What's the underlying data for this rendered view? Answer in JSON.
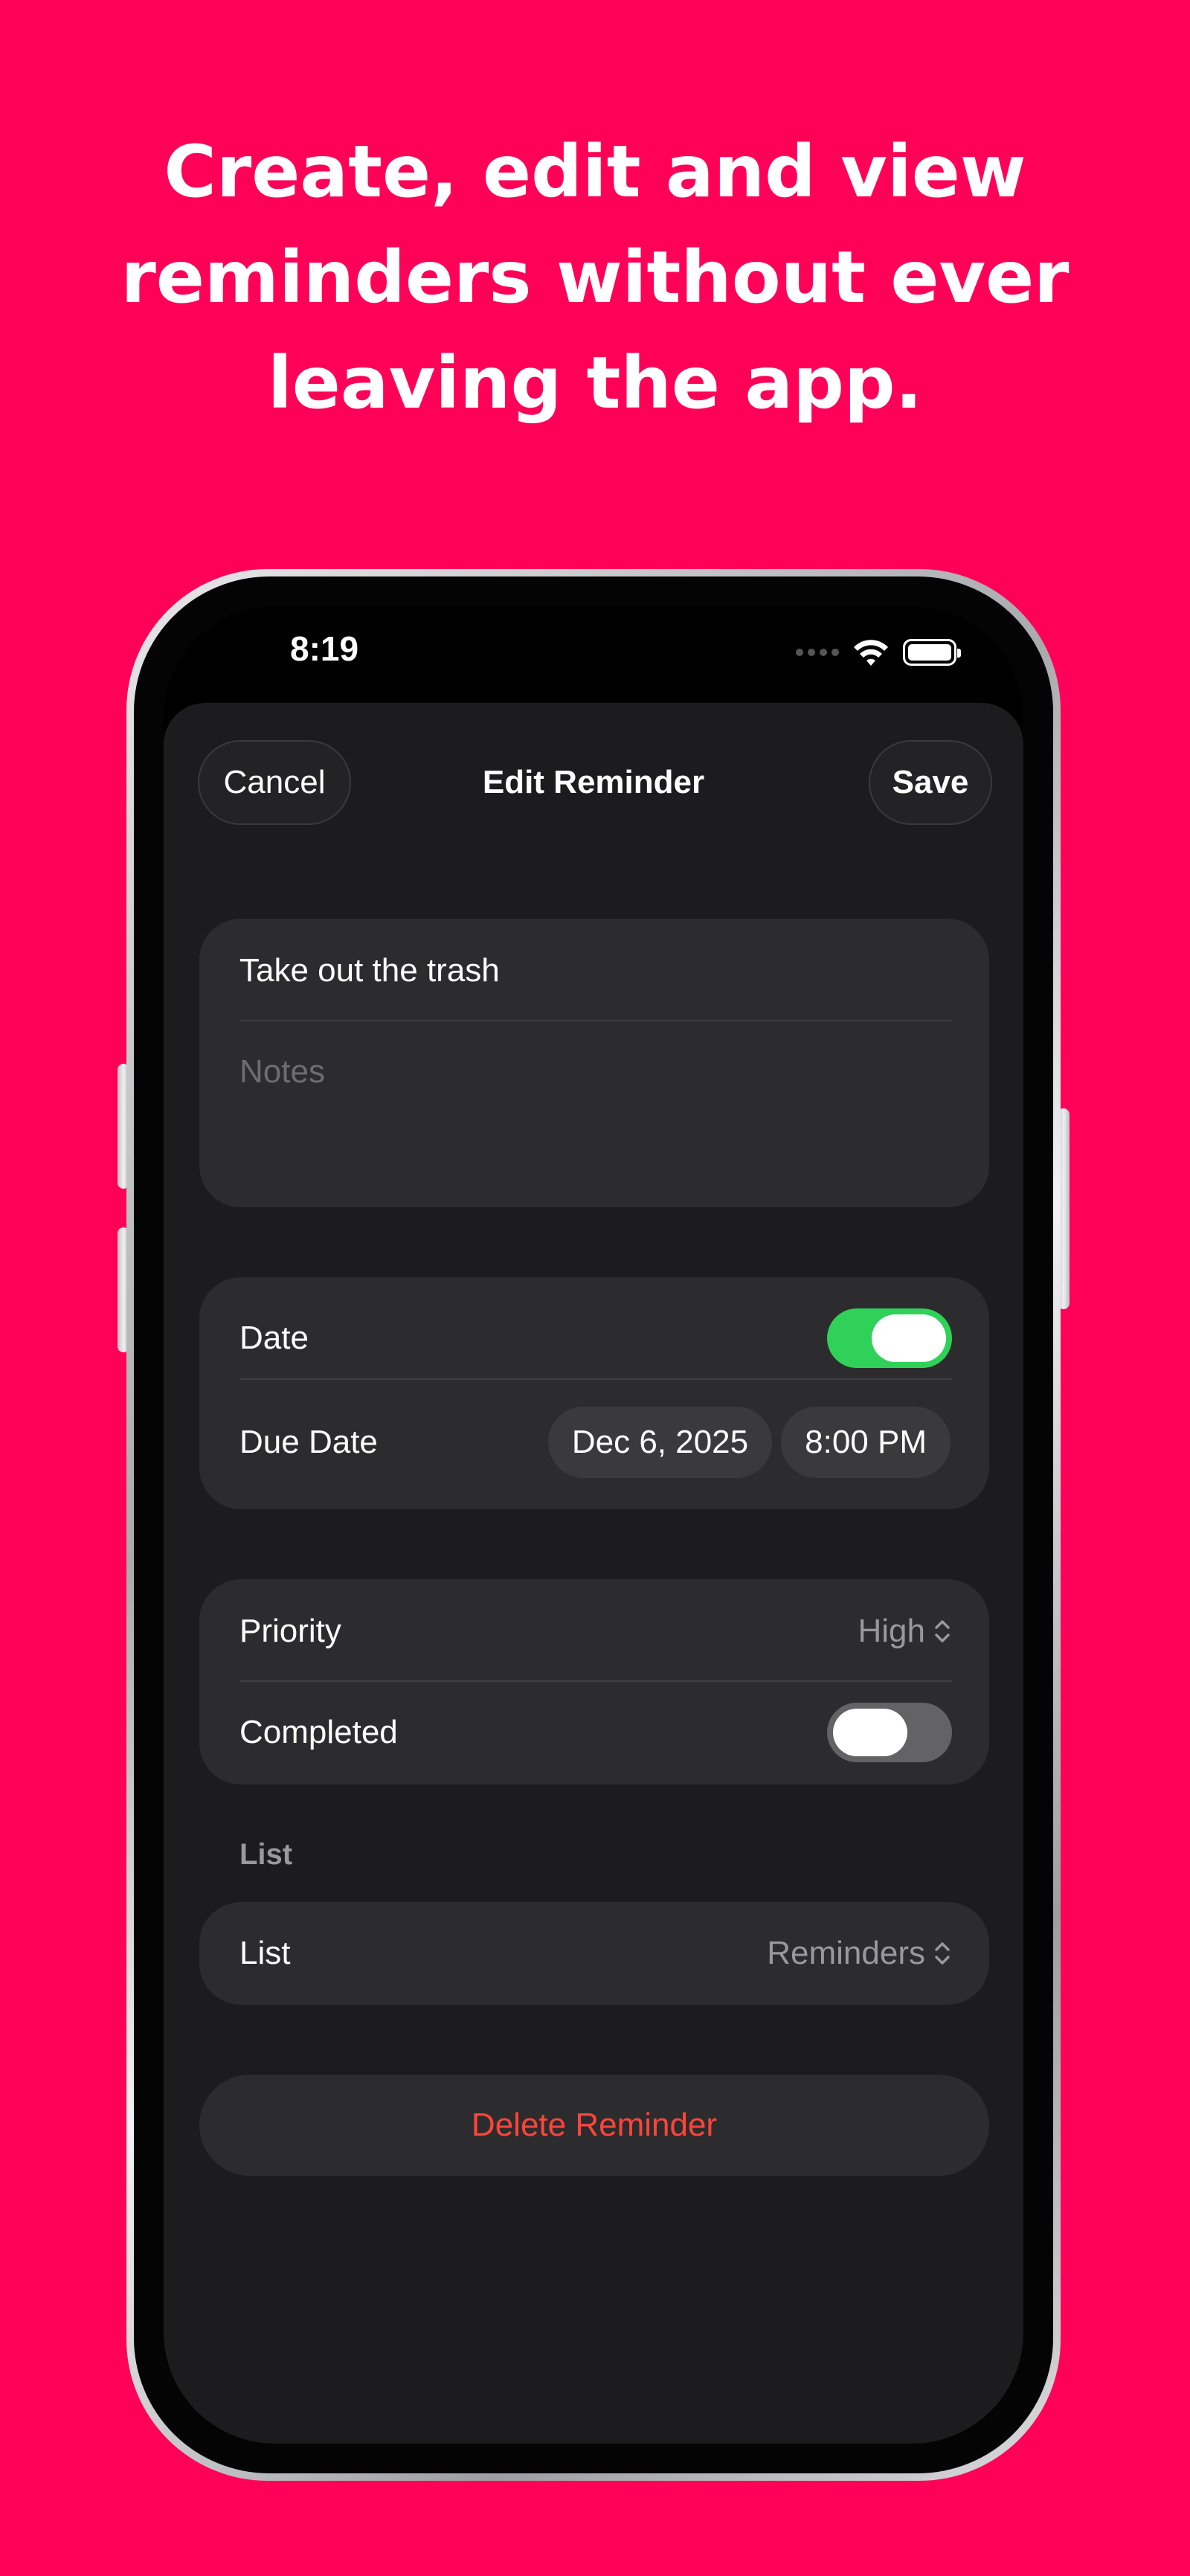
{
  "headline": {
    "line1": "Create, edit and view",
    "line2": "reminders without ever",
    "line3": "leaving the app."
  },
  "colors": {
    "background": "#FF0257",
    "accent_green": "#30D158",
    "destructive": "#FF453A"
  },
  "status_bar": {
    "time": "8:19",
    "icons": [
      "signal-dots-icon",
      "wifi-icon",
      "battery-icon"
    ]
  },
  "nav": {
    "cancel_label": "Cancel",
    "title": "Edit Reminder",
    "save_label": "Save"
  },
  "details": {
    "title_value": "Take out the trash",
    "notes_placeholder": "Notes"
  },
  "date_group": {
    "date_label": "Date",
    "date_enabled": true,
    "due_label": "Due Date",
    "due_date": "Dec 6, 2025",
    "due_time": "8:00 PM"
  },
  "status_group": {
    "priority_label": "Priority",
    "priority_value": "High",
    "completed_label": "Completed",
    "completed": false
  },
  "list_section": {
    "header": "List",
    "list_label": "List",
    "list_value": "Reminders"
  },
  "delete_label": "Delete Reminder"
}
